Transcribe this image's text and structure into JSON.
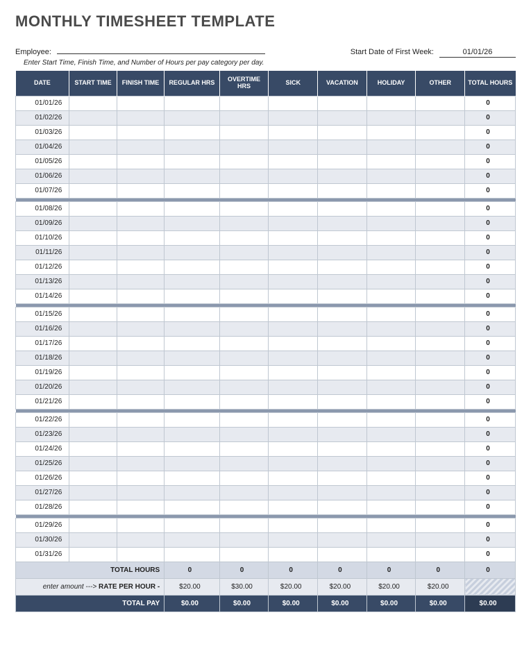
{
  "title": "MONTHLY TIMESHEET TEMPLATE",
  "employee_label": "Employee:",
  "employee_value": "",
  "start_date_label": "Start Date of First Week:",
  "start_date_value": "01/01/26",
  "instructions": "Enter Start Time, Finish Time, and Number of Hours per pay category per day.",
  "columns": {
    "date": "DATE",
    "start_time": "START TIME",
    "finish_time": "FINISH TIME",
    "regular_hrs": "REGULAR HRS",
    "overtime_hrs": "OVERTIME HRS",
    "sick": "SICK",
    "vacation": "VACATION",
    "holiday": "HOLIDAY",
    "other": "OTHER",
    "total_hours": "TOTAL HOURS"
  },
  "weeks": [
    {
      "rows": [
        {
          "date": "01/01/26",
          "total": "0"
        },
        {
          "date": "01/02/26",
          "total": "0"
        },
        {
          "date": "01/03/26",
          "total": "0"
        },
        {
          "date": "01/04/26",
          "total": "0"
        },
        {
          "date": "01/05/26",
          "total": "0"
        },
        {
          "date": "01/06/26",
          "total": "0"
        },
        {
          "date": "01/07/26",
          "total": "0"
        }
      ]
    },
    {
      "rows": [
        {
          "date": "01/08/26",
          "total": "0"
        },
        {
          "date": "01/09/26",
          "total": "0"
        },
        {
          "date": "01/10/26",
          "total": "0"
        },
        {
          "date": "01/11/26",
          "total": "0"
        },
        {
          "date": "01/12/26",
          "total": "0"
        },
        {
          "date": "01/13/26",
          "total": "0"
        },
        {
          "date": "01/14/26",
          "total": "0"
        }
      ]
    },
    {
      "rows": [
        {
          "date": "01/15/26",
          "total": "0"
        },
        {
          "date": "01/16/26",
          "total": "0"
        },
        {
          "date": "01/17/26",
          "total": "0"
        },
        {
          "date": "01/18/26",
          "total": "0"
        },
        {
          "date": "01/19/26",
          "total": "0"
        },
        {
          "date": "01/20/26",
          "total": "0"
        },
        {
          "date": "01/21/26",
          "total": "0"
        }
      ]
    },
    {
      "rows": [
        {
          "date": "01/22/26",
          "total": "0"
        },
        {
          "date": "01/23/26",
          "total": "0"
        },
        {
          "date": "01/24/26",
          "total": "0"
        },
        {
          "date": "01/25/26",
          "total": "0"
        },
        {
          "date": "01/26/26",
          "total": "0"
        },
        {
          "date": "01/27/26",
          "total": "0"
        },
        {
          "date": "01/28/26",
          "total": "0"
        }
      ]
    },
    {
      "rows": [
        {
          "date": "01/29/26",
          "total": "0"
        },
        {
          "date": "01/30/26",
          "total": "0"
        },
        {
          "date": "01/31/26",
          "total": "0"
        }
      ]
    }
  ],
  "footer": {
    "total_hours_label": "TOTAL HOURS",
    "totals": [
      "0",
      "0",
      "0",
      "0",
      "0",
      "0",
      "0"
    ],
    "rate_prefix": "enter amount --->",
    "rate_label": "RATE PER HOUR -",
    "rates": [
      "$20.00",
      "$30.00",
      "$20.00",
      "$20.00",
      "$20.00",
      "$20.00"
    ],
    "total_pay_label": "TOTAL PAY",
    "pay": [
      "$0.00",
      "$0.00",
      "$0.00",
      "$0.00",
      "$0.00",
      "$0.00",
      "$0.00"
    ]
  }
}
